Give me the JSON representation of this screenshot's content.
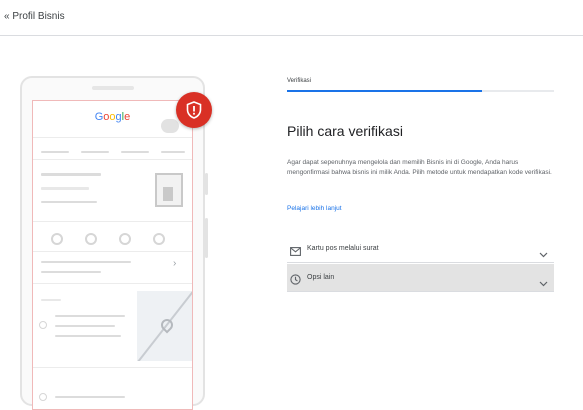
{
  "header": {
    "title": "« Profil Bisnis"
  },
  "illustration": {
    "logo_letters": [
      "G",
      "o",
      "o",
      "g",
      "l",
      "e"
    ]
  },
  "verification": {
    "step_label": "Verifikasi",
    "progress": 0.73,
    "heading": "Pilih cara verifikasi",
    "description": "Agar dapat sepenuhnya mengelola dan memilih Bisnis ini di Google, Anda harus mengonfirmasi bahwa bisnis ini milik Anda. Pilih metode untuk mendapatkan kode verifikasi.",
    "learn_more": "Pelajari lebih lanjut",
    "options": [
      {
        "label": "Kartu pos melalui surat",
        "icon": "mail-icon",
        "selected": false
      },
      {
        "label": "Opsi lain",
        "icon": "clock-icon",
        "selected": true
      }
    ]
  },
  "colors": {
    "accent": "#1a73e8",
    "badge": "#d93025",
    "selected_bg": "#e3e3e3"
  }
}
